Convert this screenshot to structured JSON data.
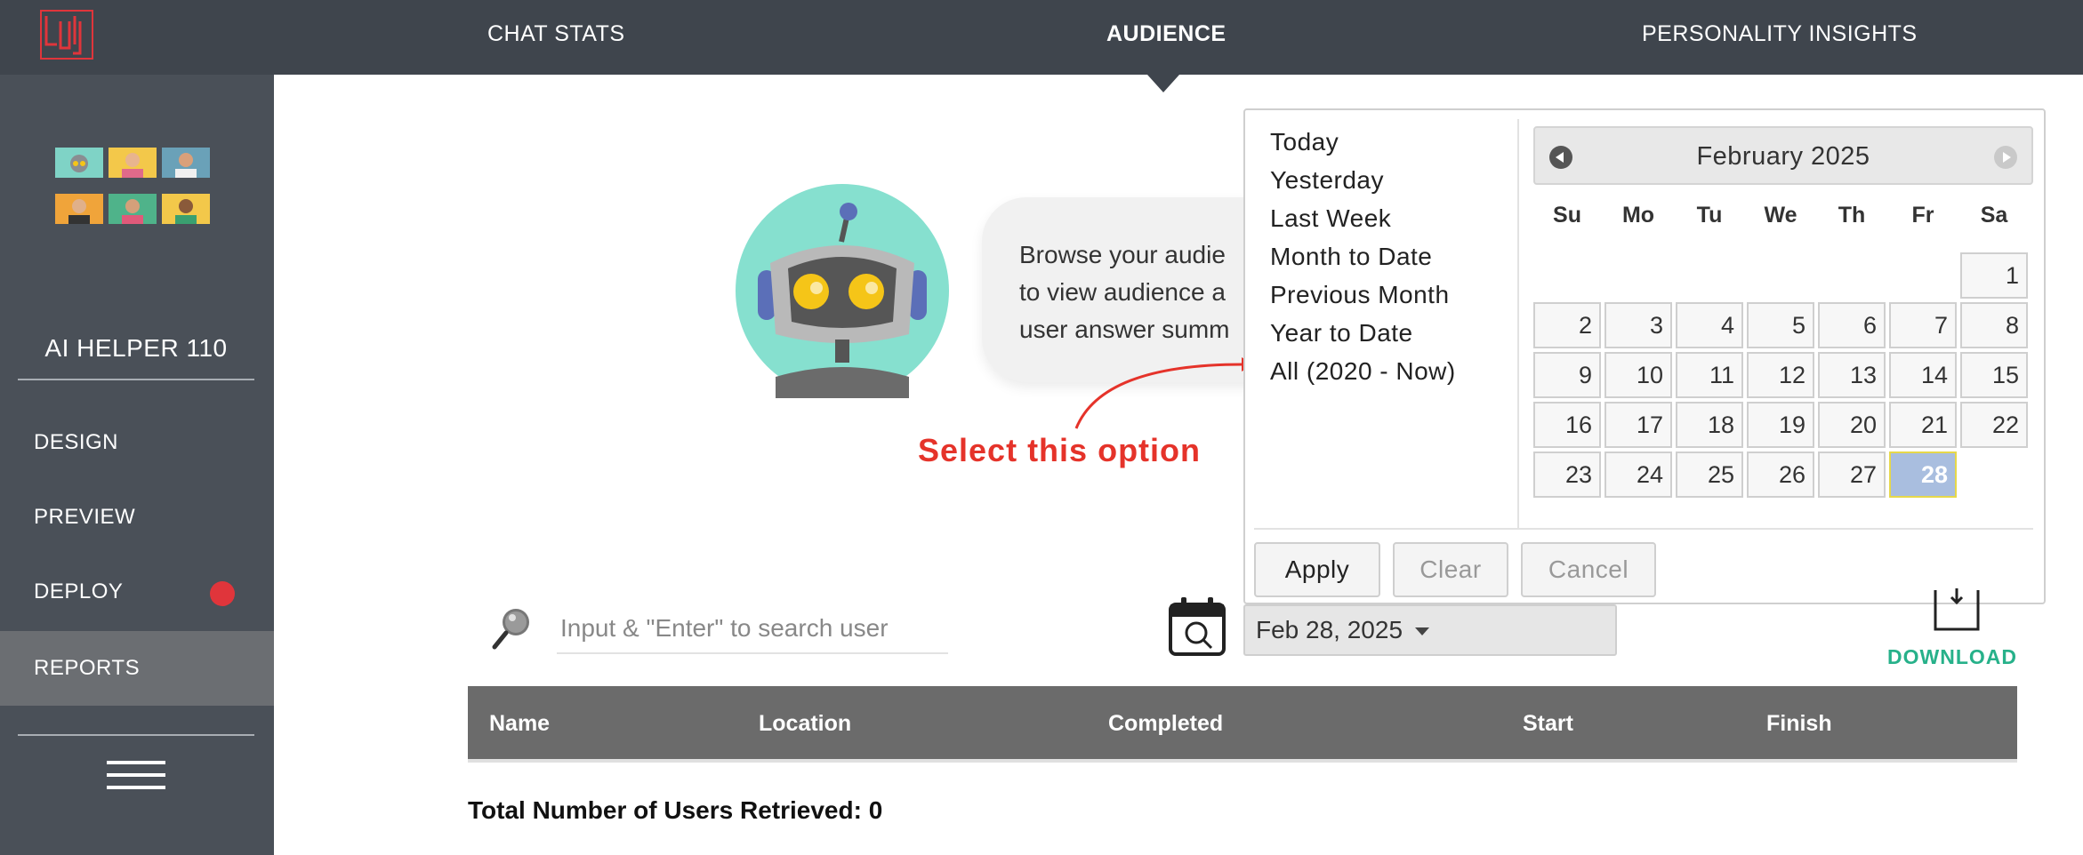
{
  "topnav": {
    "logo_alt": "Juji",
    "tabs": [
      "CHAT STATS",
      "AUDIENCE",
      "PERSONALITY INSIGHTS"
    ],
    "active_tab": "AUDIENCE"
  },
  "sidebar": {
    "bot_name": "AI HELPER 110",
    "items": [
      {
        "label": "DESIGN"
      },
      {
        "label": "PREVIEW"
      },
      {
        "label": "DEPLOY"
      },
      {
        "label": "REPORTS"
      }
    ],
    "active_item": "REPORTS"
  },
  "intro": {
    "lines": [
      "Browse your audie",
      "to view audience a",
      "user answer summ"
    ]
  },
  "annotation": "Select this option",
  "datepicker": {
    "ranges": [
      "Today",
      "Yesterday",
      "Last Week",
      "Month to Date",
      "Previous Month",
      "Year to Date",
      "All (2020 - Now)"
    ],
    "month_title": "February 2025",
    "weekdays": [
      "Su",
      "Mo",
      "Tu",
      "We",
      "Th",
      "Fr",
      "Sa"
    ],
    "selected_day": "28",
    "buttons": {
      "apply": "Apply",
      "clear": "Clear",
      "cancel": "Cancel"
    }
  },
  "search": {
    "placeholder": "Input & \"Enter\" to search user"
  },
  "date_filter": {
    "value": "Feb 28, 2025"
  },
  "download": {
    "label": "DOWNLOAD"
  },
  "table": {
    "columns": [
      "Name",
      "Location",
      "Completed",
      "Start",
      "Finish"
    ]
  },
  "total_text": "Total Number of Users Retrieved: 0",
  "colors": {
    "topbar": "#3f454d",
    "sidebar": "#4a5058",
    "accent_green": "#27b18a",
    "annotation_red": "#e5332a",
    "selected_day": "#a9bedf"
  }
}
